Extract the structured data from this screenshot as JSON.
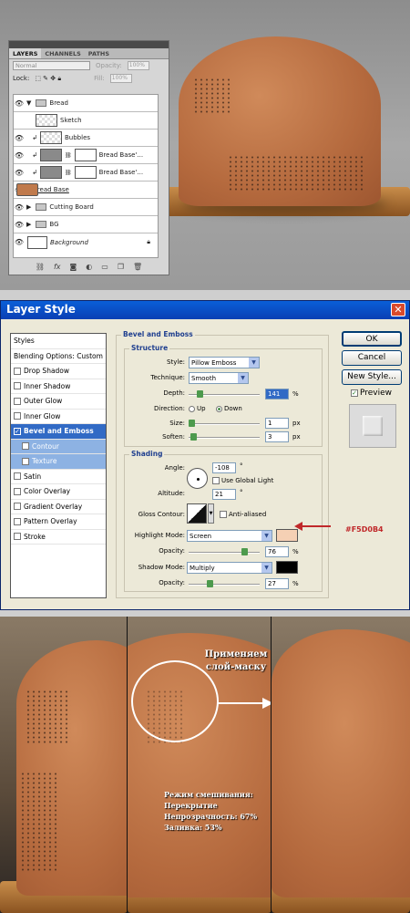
{
  "layers_panel": {
    "tabs": [
      "LAYERS",
      "CHANNELS",
      "PATHS"
    ],
    "blend_mode": "Normal",
    "opacity_label": "Opacity:",
    "opacity_value": "100%",
    "lock_label": "Lock:",
    "fill_label": "Fill:",
    "fill_value": "100%",
    "layers": [
      {
        "name": "Bread",
        "type": "group",
        "visible": true,
        "expanded": true
      },
      {
        "name": "Sketch",
        "type": "layer",
        "visible": false
      },
      {
        "name": "Bubbles",
        "type": "layer",
        "visible": true
      },
      {
        "name": "Bread Base'...",
        "type": "masked",
        "visible": true
      },
      {
        "name": "Bread Base'...",
        "type": "masked",
        "visible": true
      },
      {
        "name": "Bread Base",
        "type": "layer",
        "visible": true
      },
      {
        "name": "Cutting Board",
        "type": "group",
        "visible": true,
        "expanded": false
      },
      {
        "name": "BG",
        "type": "group",
        "visible": true,
        "expanded": false
      },
      {
        "name": "Background",
        "type": "background",
        "visible": true
      }
    ],
    "footer_icons": [
      "link-icon",
      "fx-icon",
      "mask-icon",
      "adjustment-icon",
      "folder-icon",
      "new-layer-icon",
      "trash-icon"
    ]
  },
  "layer_style": {
    "title": "Layer Style",
    "styles_header": "Styles",
    "blending_options": "Blending Options: Custom",
    "style_items": [
      {
        "label": "Drop Shadow",
        "checked": false
      },
      {
        "label": "Inner Shadow",
        "checked": false
      },
      {
        "label": "Outer Glow",
        "checked": false
      },
      {
        "label": "Inner Glow",
        "checked": false
      },
      {
        "label": "Bevel and Emboss",
        "checked": true,
        "selected": true
      },
      {
        "label": "Contour",
        "checked": false,
        "sub": true
      },
      {
        "label": "Texture",
        "checked": false,
        "sub": true
      },
      {
        "label": "Satin",
        "checked": false
      },
      {
        "label": "Color Overlay",
        "checked": false
      },
      {
        "label": "Gradient Overlay",
        "checked": false
      },
      {
        "label": "Pattern Overlay",
        "checked": false
      },
      {
        "label": "Stroke",
        "checked": false
      }
    ],
    "group_title": "Bevel and Emboss",
    "structure_title": "Structure",
    "style_label": "Style:",
    "style_value": "Pillow Emboss",
    "technique_label": "Technique:",
    "technique_value": "Smooth",
    "depth_label": "Depth:",
    "depth_value": "141",
    "depth_unit": "%",
    "direction_label": "Direction:",
    "direction_up": "Up",
    "direction_down": "Down",
    "size_label": "Size:",
    "size_value": "1",
    "size_unit": "px",
    "soften_label": "Soften:",
    "soften_value": "3",
    "soften_unit": "px",
    "shading_title": "Shading",
    "angle_label": "Angle:",
    "angle_value": "-108",
    "angle_unit": "°",
    "use_global_light": "Use Global Light",
    "altitude_label": "Altitude:",
    "altitude_value": "21",
    "altitude_unit": "°",
    "gloss_label": "Gloss Contour:",
    "anti_aliased": "Anti-aliased",
    "highlight_label": "Highlight Mode:",
    "highlight_value": "Screen",
    "highlight_color": "#F5D0B4",
    "opacity_label": "Opacity:",
    "highlight_opacity": "76",
    "opacity_unit": "%",
    "shadow_label": "Shadow Mode:",
    "shadow_value": "Multiply",
    "shadow_color": "#000000",
    "shadow_opacity": "27",
    "buttons": {
      "ok": "OK",
      "cancel": "Cancel",
      "new_style": "New Style...",
      "preview": "Preview"
    },
    "color_annotation": "#F5D0B4",
    "annotation_color": "#c0282a"
  },
  "bottom": {
    "apply_mask_line1": "Применяем",
    "apply_mask_line2": "слой-маску",
    "blend_line1": "Режим смешивания:",
    "blend_line2": "Перекрытие",
    "blend_line3": "Непрозрачность: 67%",
    "blend_line4": "Заливка: 53%"
  }
}
